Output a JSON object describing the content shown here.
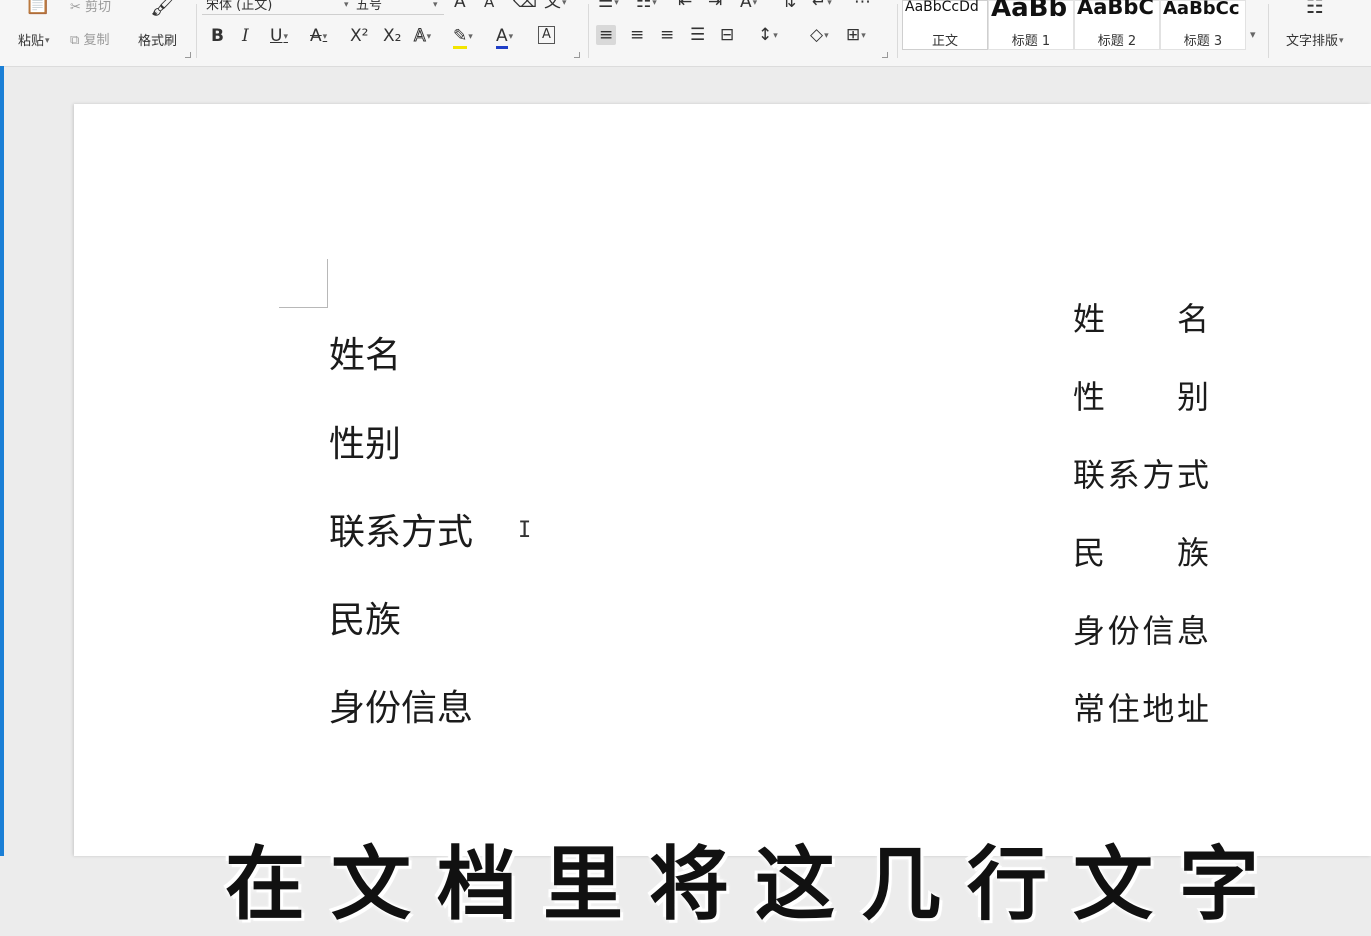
{
  "toolbar": {
    "clipboard": {
      "paste": "粘贴",
      "cut": "剪切",
      "copy": "复制",
      "format_painter": "格式刷"
    },
    "font": {
      "family": "宋体 (正文)",
      "size": "五号",
      "bold": "B",
      "italic": "I",
      "underline": "U",
      "strikethrough": "A",
      "superscript": "X²",
      "subscript": "X₂",
      "text_effect": "A",
      "highlight_color": "#f3e500",
      "font_color": "#1f3ec7",
      "char_border": "A"
    },
    "styles": [
      {
        "name": "正文",
        "sample": "AaBbCcDd"
      },
      {
        "name": "标题 1",
        "sample": "AaBb"
      },
      {
        "name": "标题 2",
        "sample": "AaBbC"
      },
      {
        "name": "标题 3",
        "sample": "AaBbCc"
      }
    ],
    "text_layout": "文字排版"
  },
  "document": {
    "left_lines": [
      "姓名",
      "性别",
      "联系方式",
      "民族",
      "身份信息"
    ],
    "right_lines": [
      "姓名",
      "性别",
      "联系方式",
      "民族",
      "身份信息",
      "常住地址"
    ]
  },
  "caption": "在文档里将这几行文字"
}
